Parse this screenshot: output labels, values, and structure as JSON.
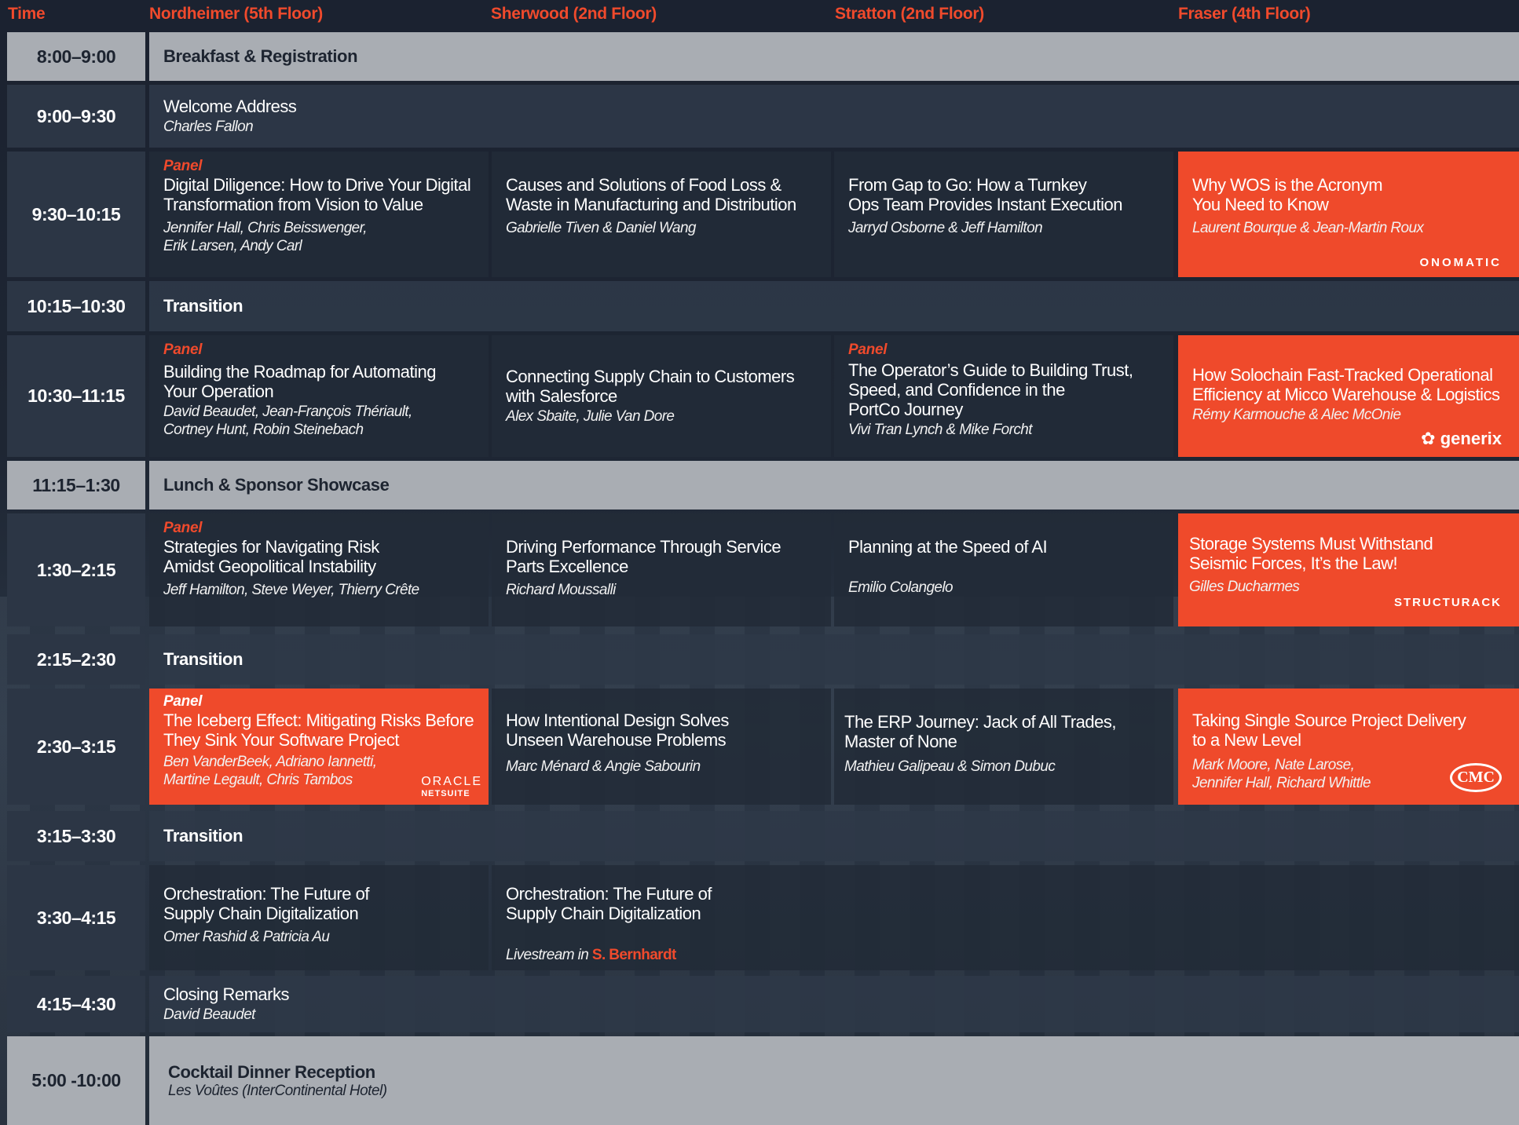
{
  "headers": {
    "time": "Time",
    "r1": "Nordheimer (5th Floor)",
    "r2": "Sherwood (2nd Floor)",
    "r3": "Stratton (2nd Floor)",
    "r4": "Fraser (4th Floor)"
  },
  "row1": {
    "time": "8:00–9:00",
    "title": "Breakfast & Registration"
  },
  "row2": {
    "time": "9:00–9:30",
    "title": "Welcome Address",
    "speaker": "Charles Fallon"
  },
  "row3": {
    "time": "9:30–10:15",
    "c1": {
      "tag": "Panel",
      "title": "Digital Diligence: How to Drive Your Digital\nTransformation from Vision to Value",
      "speakers": "Jennifer Hall, Chris Beisswenger,\nErik Larsen, Andy Carl"
    },
    "c2": {
      "title": "Causes and Solutions of  Food Loss &\nWaste in Manufacturing and Distribution",
      "speakers": "Gabrielle Tiven & Daniel Wang"
    },
    "c3": {
      "title": "From Gap to Go: How a Turnkey\nOps Team Provides Instant Execution",
      "speakers": "Jarryd Osborne & Jeff Hamilton"
    },
    "c4": {
      "title": "Why WOS is the  Acronym\nYou Need to Know",
      "speakers": "Laurent Bourque & Jean-Martin Roux",
      "logo": "ONOMATIC"
    }
  },
  "row4": {
    "time": "10:15–10:30",
    "title": "Transition"
  },
  "row5": {
    "time": "10:30–11:15",
    "c1": {
      "tag": "Panel",
      "title": "Building the Roadmap for Automating\nYour Operation",
      "speakers": "David Beaudet, Jean-François Thériault,\nCortney Hunt, Robin Steinebach"
    },
    "c2": {
      "title": "Connecting Supply Chain to Customers\nwith Salesforce",
      "speakers": "Alex Sbaite, Julie Van Dore"
    },
    "c3": {
      "tag": "Panel",
      "title": "The Operator’s Guide to Building Trust,\nSpeed, and Confidence in the\nPortCo Journey",
      "speakers": "Vivi Tran Lynch & Mike Forcht"
    },
    "c4": {
      "title": "How Solochain Fast-Tracked Operational\nEfficiency at Micco Warehouse & Logistics",
      "speakers": "Rémy Karmouche & Alec McOnie",
      "logo": "generix"
    }
  },
  "row6": {
    "time": "11:15–1:30",
    "title": "Lunch & Sponsor Showcase"
  },
  "row7": {
    "time": "1:30–2:15",
    "c1": {
      "tag": "Panel",
      "title": "Strategies for Navigating Risk\nAmidst Geopolitical Instability",
      "speakers": "Jeff Hamilton, Steve Weyer, Thierry Crête"
    },
    "c2": {
      "title": "Driving Performance Through Service\nParts Excellence",
      "speakers": "Richard Moussalli"
    },
    "c3": {
      "title": "Planning at the Speed of AI",
      "speakers": "Emilio Colangelo"
    },
    "c4": {
      "title": "Storage Systems Must Withstand\nSeismic Forces, It’s the Law!",
      "speakers": "Gilles Ducharmes",
      "logo": "STRUCTURACK"
    }
  },
  "row8": {
    "time": "2:15–2:30",
    "title": "Transition"
  },
  "row9": {
    "time": "2:30–3:15",
    "c1": {
      "tag": "Panel",
      "title": "The Iceberg Effect: Mitigating Risks Before\nThey Sink Your Software Project",
      "speakers": "Ben VanderBeek, Adriano Iannetti,\nMartine Legault, Chris Tambos",
      "logo": "ORACLE",
      "logo_sub": "NETSUITE"
    },
    "c2": {
      "title": "How Intentional Design Solves\nUnseen Warehouse Problems",
      "speakers": "Marc Ménard & Angie Sabourin"
    },
    "c3": {
      "title": "The ERP Journey: Jack of All Trades,\nMaster of None",
      "speakers": "Mathieu Galipeau & Simon Dubuc"
    },
    "c4": {
      "title": "Taking Single Source Project Delivery\nto a New Level",
      "speakers": "Mark Moore, Nate Larose,\nJennifer Hall, Richard Whittle",
      "logo": "CMC"
    }
  },
  "row10": {
    "time": "3:15–3:30",
    "title": "Transition"
  },
  "row11": {
    "time": "3:30–4:15",
    "c1": {
      "title": "Orchestration: The Future of\nSupply Chain Digitalization",
      "speakers": "Omer Rashid & Patricia Au"
    },
    "c2": {
      "title": "Orchestration: The Future of\nSupply Chain Digitalization",
      "livestream": "Livestream in ",
      "venue": "S. Bernhardt"
    }
  },
  "row12": {
    "time": "4:15–4:30",
    "title": "Closing Remarks",
    "speaker": "David Beaudet"
  },
  "row13": {
    "time": "5:00 -10:00",
    "title": "Cocktail Dinner Reception",
    "venue": "Les Voûtes (InterContinental Hotel)"
  },
  "colors": {
    "accent": "#ef4a2b",
    "dark_cell": "#222b38",
    "light_band": "#a9adb3"
  }
}
